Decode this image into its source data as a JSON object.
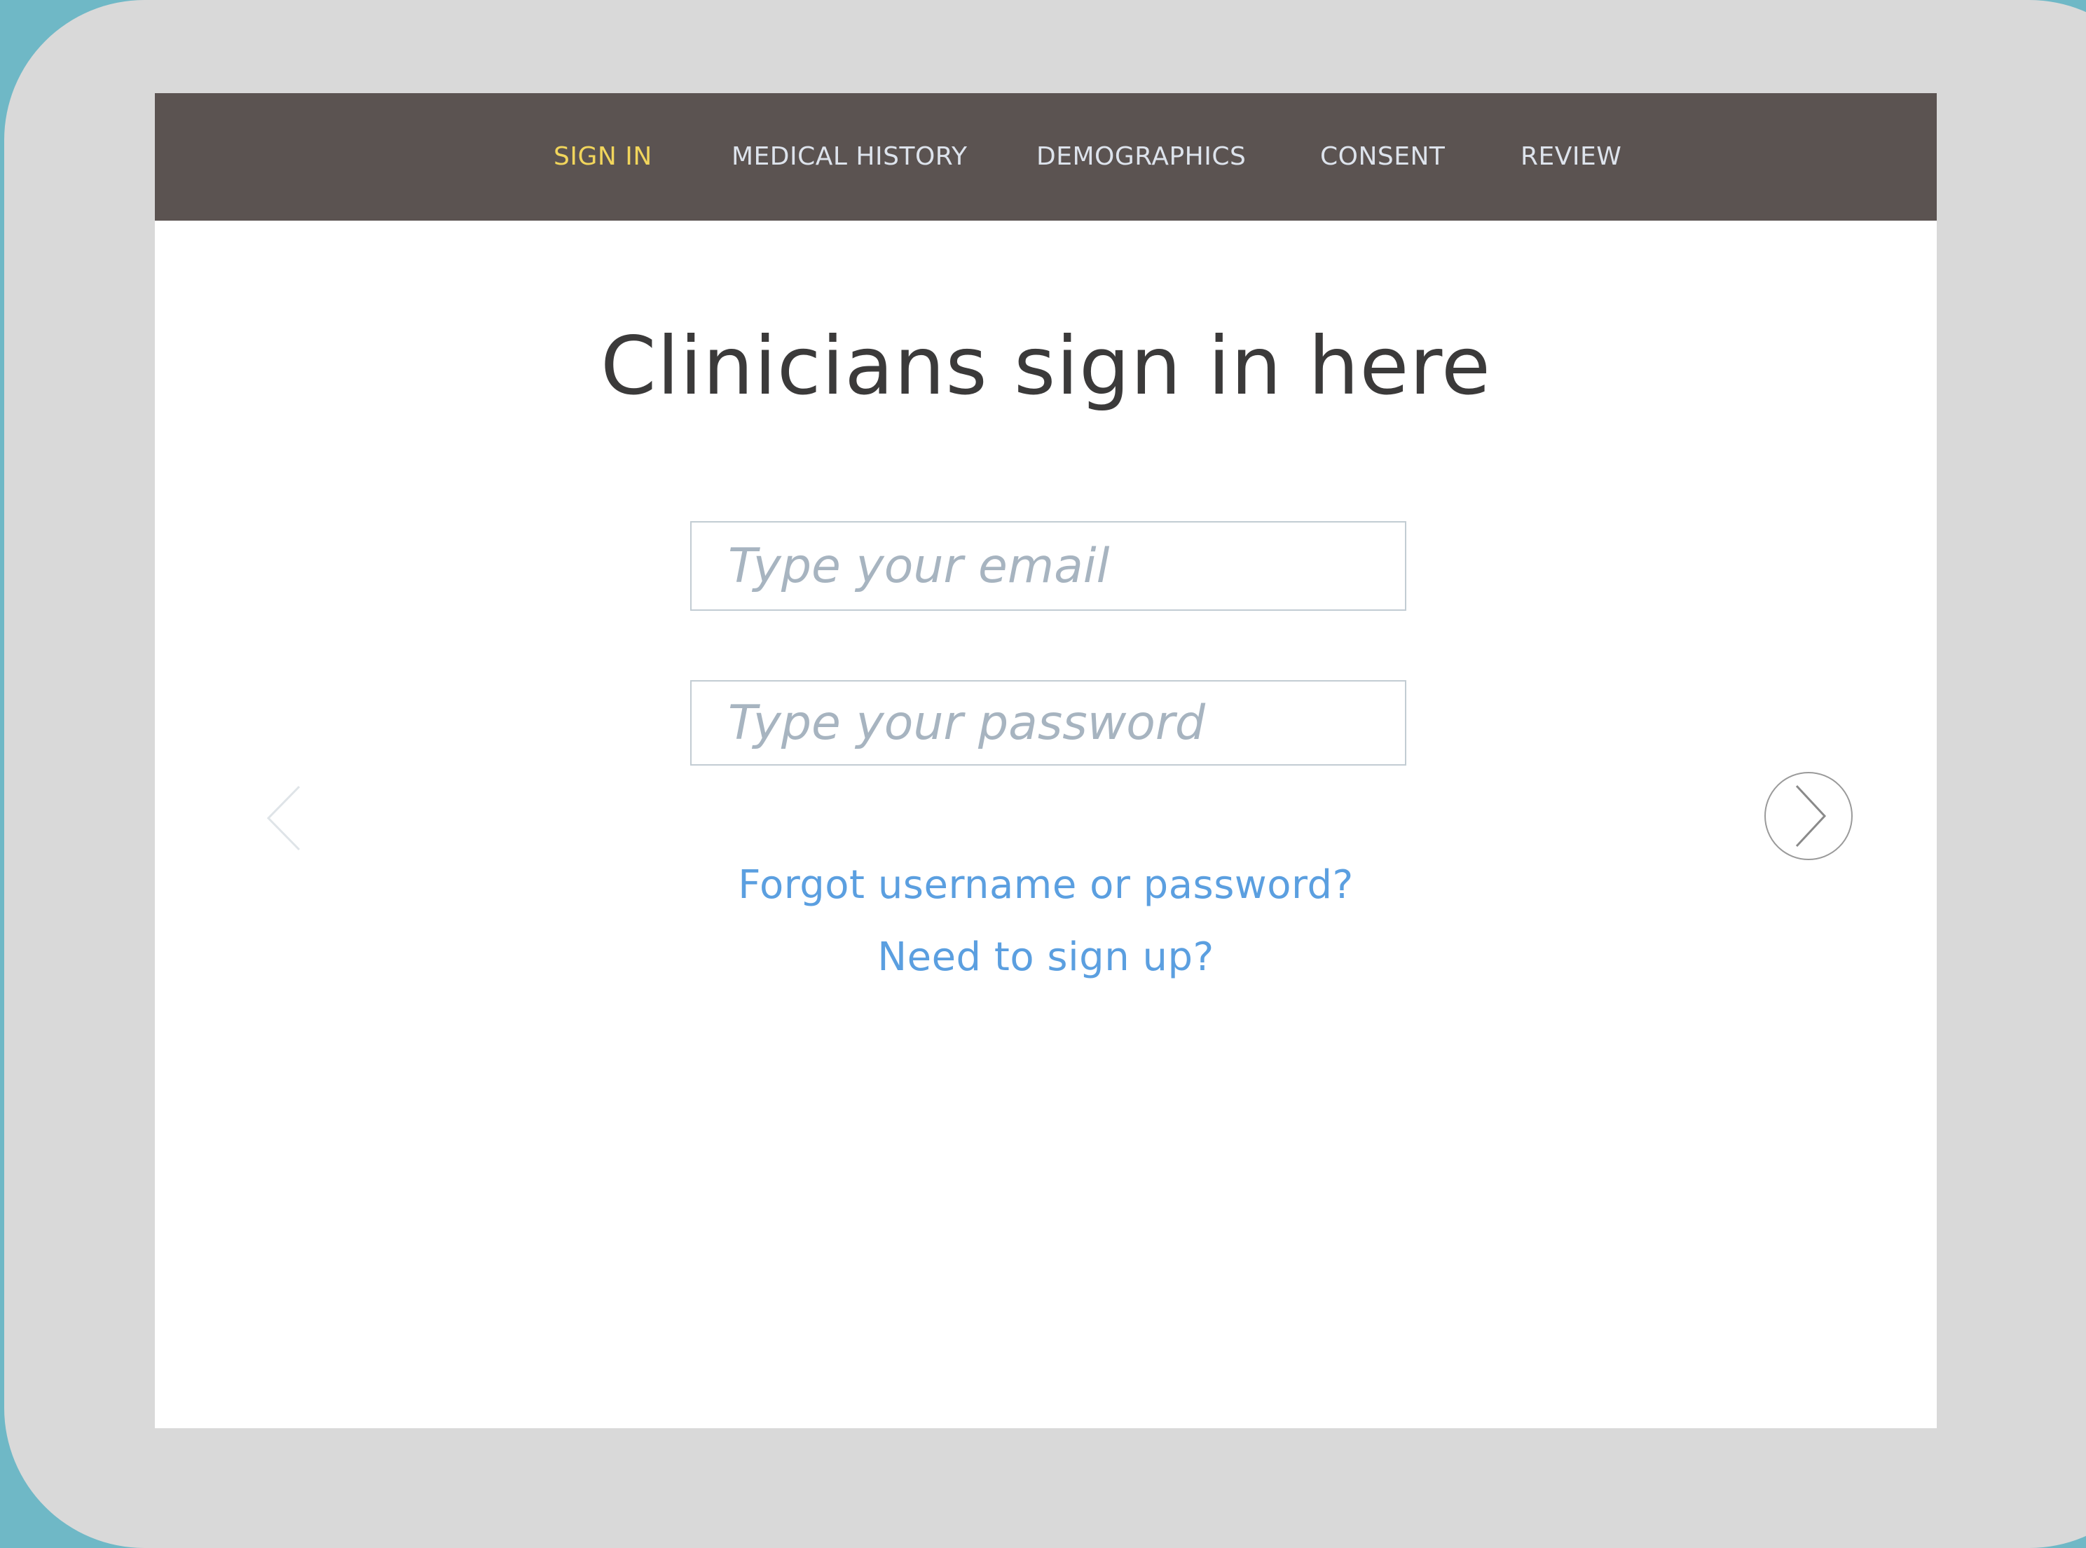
{
  "nav": {
    "items": [
      {
        "label": "SIGN IN",
        "active": true
      },
      {
        "label": "MEDICAL HISTORY",
        "active": false
      },
      {
        "label": "DEMOGRAPHICS",
        "active": false
      },
      {
        "label": "CONSENT",
        "active": false
      },
      {
        "label": "REVIEW",
        "active": false
      }
    ]
  },
  "main": {
    "title": "Clinicians sign in here",
    "email": {
      "value": "",
      "placeholder": "Type your email"
    },
    "password": {
      "value": "",
      "placeholder": "Type your password"
    },
    "forgot_link": "Forgot username or password?",
    "signup_link": "Need to sign up?"
  },
  "icons": {
    "prev": "chevron-left-icon",
    "next": "chevron-right-circle-icon"
  },
  "colors": {
    "nav_background": "#5b5351",
    "nav_text": "#dde3ec",
    "nav_active": "#f1d55c",
    "link": "#5b9fe0",
    "title": "#3b3a3a",
    "placeholder": "#a7b4c0",
    "device_bezel": "#d9d9d9",
    "outer_background": "#6fb8c6"
  }
}
